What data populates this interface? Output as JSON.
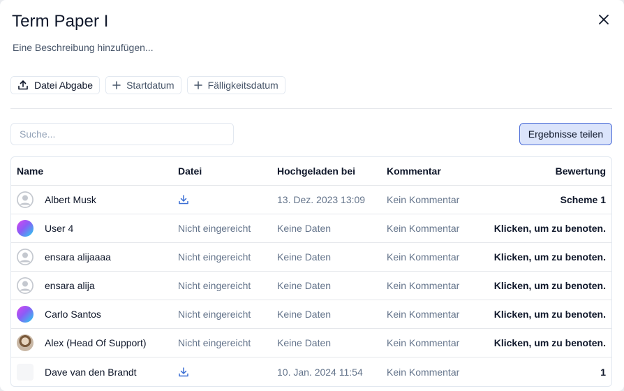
{
  "modal": {
    "title": "Term Paper I",
    "description_placeholder": "Eine Beschreibung hinzufügen..."
  },
  "actions": {
    "submission": "Datei Abgabe",
    "start_date": "Startdatum",
    "due_date": "Fälligkeitsdatum"
  },
  "search": {
    "placeholder": "Suche..."
  },
  "share_button": "Ergebnisse teilen",
  "table": {
    "headers": {
      "name": "Name",
      "file": "Datei",
      "uploaded": "Hochgeladen bei",
      "comment": "Kommentar",
      "grade": "Bewertung"
    },
    "rows": [
      {
        "name": "Albert Musk",
        "avatar": "default-user-avatar",
        "file": "download-icon",
        "uploaded": "13. Dez. 2023 13:09",
        "comment": "Kein Kommentar",
        "grade": "Scheme 1"
      },
      {
        "name": "User 4",
        "avatar": "gradient-avatar",
        "file": "Nicht eingereicht",
        "uploaded": "Keine Daten",
        "comment": "Kein Kommentar",
        "grade": "Klicken, um zu benoten."
      },
      {
        "name": "ensara alijaaaa",
        "avatar": "default-user-avatar",
        "file": "Nicht eingereicht",
        "uploaded": "Keine Daten",
        "comment": "Kein Kommentar",
        "grade": "Klicken, um zu benoten."
      },
      {
        "name": "ensara alija",
        "avatar": "default-user-avatar",
        "file": "Nicht eingereicht",
        "uploaded": "Keine Daten",
        "comment": "Kein Kommentar",
        "grade": "Klicken, um zu benoten."
      },
      {
        "name": "Carlo Santos",
        "avatar": "gradient-avatar",
        "file": "Nicht eingereicht",
        "uploaded": "Keine Daten",
        "comment": "Kein Kommentar",
        "grade": "Klicken, um zu benoten."
      },
      {
        "name": "Alex (Head Of Support)",
        "avatar": "photo-avatar",
        "file": "Nicht eingereicht",
        "uploaded": "Keine Daten",
        "comment": "Kein Kommentar",
        "grade": "Klicken, um zu benoten."
      },
      {
        "name": "Dave van den Brandt",
        "avatar": "blank-avatar",
        "file": "download-icon",
        "uploaded": "10. Jan. 2024 11:54",
        "comment": "Kein Kommentar",
        "grade": "1"
      }
    ]
  },
  "colors": {
    "accent_border": "#4f6fd8",
    "accent_bg": "#dbe4fb",
    "download_icon": "#3b6fd4",
    "muted_text": "#64748b"
  }
}
